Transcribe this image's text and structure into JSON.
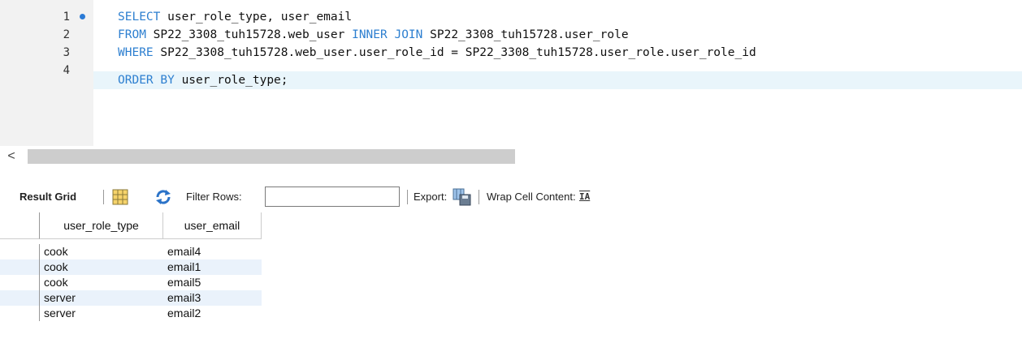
{
  "editor": {
    "lines": [
      {
        "number": "1",
        "has_marker": true
      },
      {
        "number": "2",
        "has_marker": false
      },
      {
        "number": "3",
        "has_marker": false
      },
      {
        "number": "4",
        "has_marker": false
      }
    ],
    "code": {
      "l1_kw": "SELECT",
      "l1_rest": " user_role_type, user_email",
      "l2_kw1": "FROM",
      "l2_mid": " SP22_3308_tuh15728.web_user ",
      "l2_kw2": "INNER JOIN",
      "l2_rest": " SP22_3308_tuh15728.user_role",
      "l3_kw": "WHERE",
      "l3_rest": " SP22_3308_tuh15728.web_user.user_role_id = SP22_3308_tuh15728.user_role.user_role_id",
      "l4_kw": "ORDER BY",
      "l4_rest": " user_role_type;"
    },
    "scroll_left_icon": "<"
  },
  "toolbar": {
    "result_grid_label": "Result Grid",
    "filter_rows_label": "Filter Rows:",
    "filter_value": "",
    "export_label": "Export:",
    "wrap_label": "Wrap Cell Content:",
    "wrap_icon_text": "IA"
  },
  "grid": {
    "columns": [
      "user_role_type",
      "user_email"
    ],
    "rows": [
      [
        "cook",
        "email4"
      ],
      [
        "cook",
        "email1"
      ],
      [
        "cook",
        "email5"
      ],
      [
        "server",
        "email3"
      ],
      [
        "server",
        "email2"
      ]
    ]
  },
  "colors": {
    "keyword": "#2d7fd0",
    "current_line": "#e9f5fb",
    "alt_row": "#eaf2fb",
    "marker": "#2b7bd6"
  }
}
